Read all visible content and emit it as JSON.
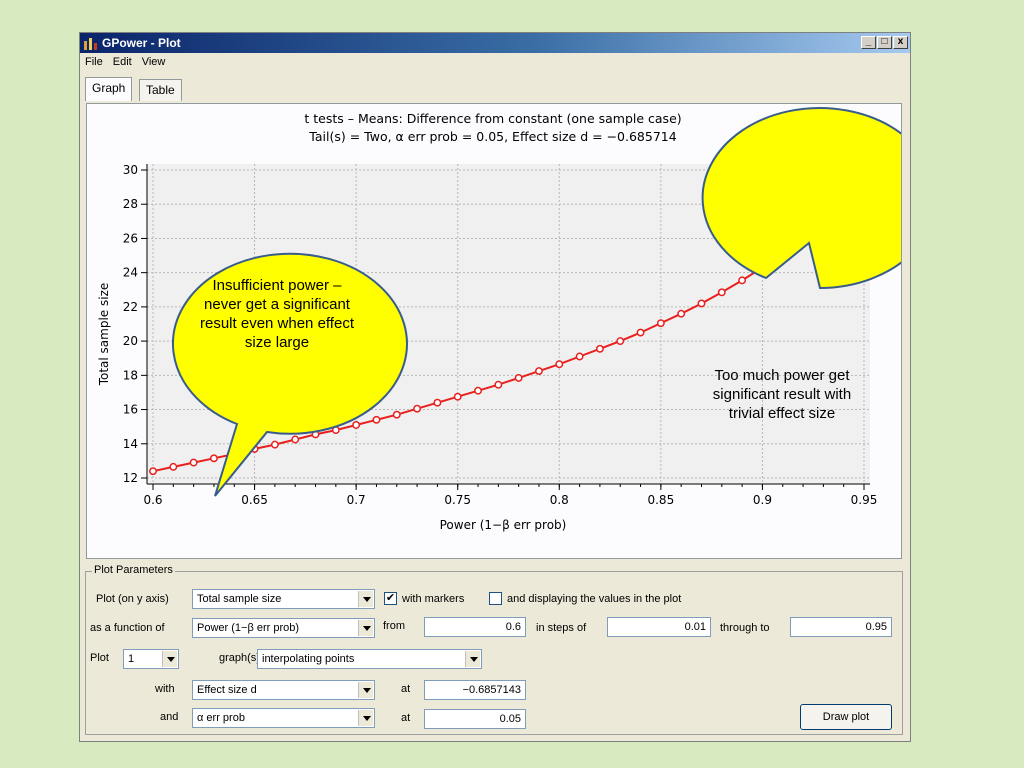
{
  "window": {
    "title": "GPower - Plot",
    "menu": [
      "File",
      "Edit",
      "View"
    ],
    "tabs": [
      "Graph",
      "Table"
    ],
    "active_tab": "Graph",
    "controls": [
      "_",
      "□",
      "x"
    ]
  },
  "chart_data": {
    "type": "line",
    "title": "t tests – Means: Difference from constant (one sample case)",
    "subtitle": "Tail(s) = Two, α err prob = 0.05, Effect size d = −0.685714",
    "xlabel": "Power (1−β err prob)",
    "ylabel": "Total sample size",
    "xlim": [
      0.6,
      0.95
    ],
    "ylim": [
      12,
      30
    ],
    "xticks": [
      "0.6",
      "0.65",
      "0.7",
      "0.75",
      "0.8",
      "0.85",
      "0.9",
      "0.95"
    ],
    "yticks": [
      "12",
      "14",
      "16",
      "18",
      "20",
      "22",
      "24",
      "26",
      "28",
      "30"
    ],
    "grid": true,
    "markers": true,
    "color": "#e8201e",
    "x": [
      0.6,
      0.61,
      0.62,
      0.63,
      0.64,
      0.65,
      0.66,
      0.67,
      0.68,
      0.69,
      0.7,
      0.71,
      0.72,
      0.73,
      0.74,
      0.75,
      0.76,
      0.77,
      0.78,
      0.79,
      0.8,
      0.81,
      0.82,
      0.83,
      0.84,
      0.85,
      0.86,
      0.87,
      0.88,
      0.89,
      0.9,
      0.91,
      0.92,
      0.93,
      0.94,
      0.95
    ],
    "y": [
      12.4,
      12.65,
      12.9,
      13.15,
      13.4,
      13.7,
      13.95,
      14.25,
      14.55,
      14.8,
      15.1,
      15.4,
      15.7,
      16.05,
      16.4,
      16.75,
      17.1,
      17.45,
      17.85,
      18.25,
      18.65,
      19.1,
      19.55,
      20.0,
      20.5,
      21.05,
      21.6,
      22.2,
      22.85,
      23.55,
      24.3,
      25.1,
      26.0,
      27.0,
      28.2,
      29.6
    ]
  },
  "callouts": {
    "left": "Insufficient power – never get a significant result even when effect size large",
    "right": "Too much power get significant result with trivial effect size",
    "fill": "#ffff00",
    "stroke": "#385d8a"
  },
  "params": {
    "legend": "Plot Parameters",
    "plot_on_y_label": "Plot (on y axis)",
    "plot_on_y_value": "Total sample size",
    "with_markers_label": "with markers",
    "with_markers_checked": true,
    "display_values_label": "and displaying the values in the plot",
    "display_values_checked": false,
    "function_of_label": "as a function of",
    "function_of_value": "Power (1−β err prob)",
    "from_label": "from",
    "from_value": "0.6",
    "steps_label": "in steps of",
    "steps_value": "0.01",
    "through_label": "through to",
    "through_value": "0.95",
    "plot_label": "Plot",
    "plot_count": "1",
    "graphs_label": "graph(s)",
    "graphs_mode": "interpolating points",
    "with_label": "with",
    "with_value": "Effect size d",
    "at1_label": "at",
    "at1_value": "−0.6857143",
    "and_label": "and",
    "and_value": "α err prob",
    "at2_label": "at",
    "at2_value": "0.05",
    "draw_button": "Draw plot"
  }
}
